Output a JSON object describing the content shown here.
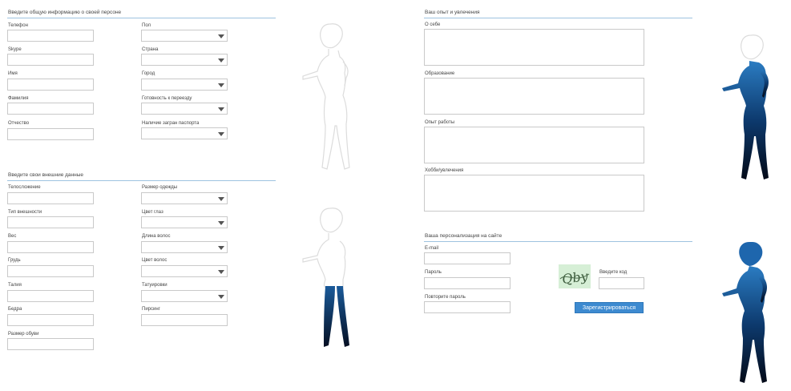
{
  "personal": {
    "title": "Введите общую информацию о своей персоне",
    "phone": "Телефон",
    "skype": "Skype",
    "name": "Имя",
    "surname": "Фамилия",
    "patronymic": "Отчество",
    "gender": "Пол",
    "country": "Страна",
    "city": "Город",
    "relocation": "Готовность к переезду",
    "passport": "Наличие загран паспорта"
  },
  "appearance": {
    "title": "Введите свои внешние данные",
    "body_type": "Телосложение",
    "look_type": "Тип внешности",
    "weight": "Вес",
    "chest": "Грудь",
    "waist": "Талия",
    "hips": "Бедра",
    "shoe_size": "Размер обуви",
    "clothing_size": "Размер одежды",
    "eye_color": "Цвет глаз",
    "hair_length": "Длина волос",
    "hair_color": "Цвет волос",
    "tattoos": "Татуировки",
    "piercing": "Пирсинг"
  },
  "experience": {
    "title": "Ваш опыт и увлечения",
    "about": "О себе",
    "education": "Образование",
    "work": "Опыт работы",
    "hobby": "Хобби/увлечения"
  },
  "account": {
    "title": "Ваша персонализация на сайте",
    "email": "E-mail",
    "password": "Пароль",
    "repeat_password": "Повторите пароль",
    "captcha_label": "Введите код",
    "captcha_text": "Qby",
    "submit": "Зарегистрироваться"
  },
  "colors": {
    "accent": "#3d8ad0",
    "section_line": "#9ec3e0",
    "silhouette_fill": "#0d3a6e",
    "captcha_bg": "#d6efd6"
  }
}
